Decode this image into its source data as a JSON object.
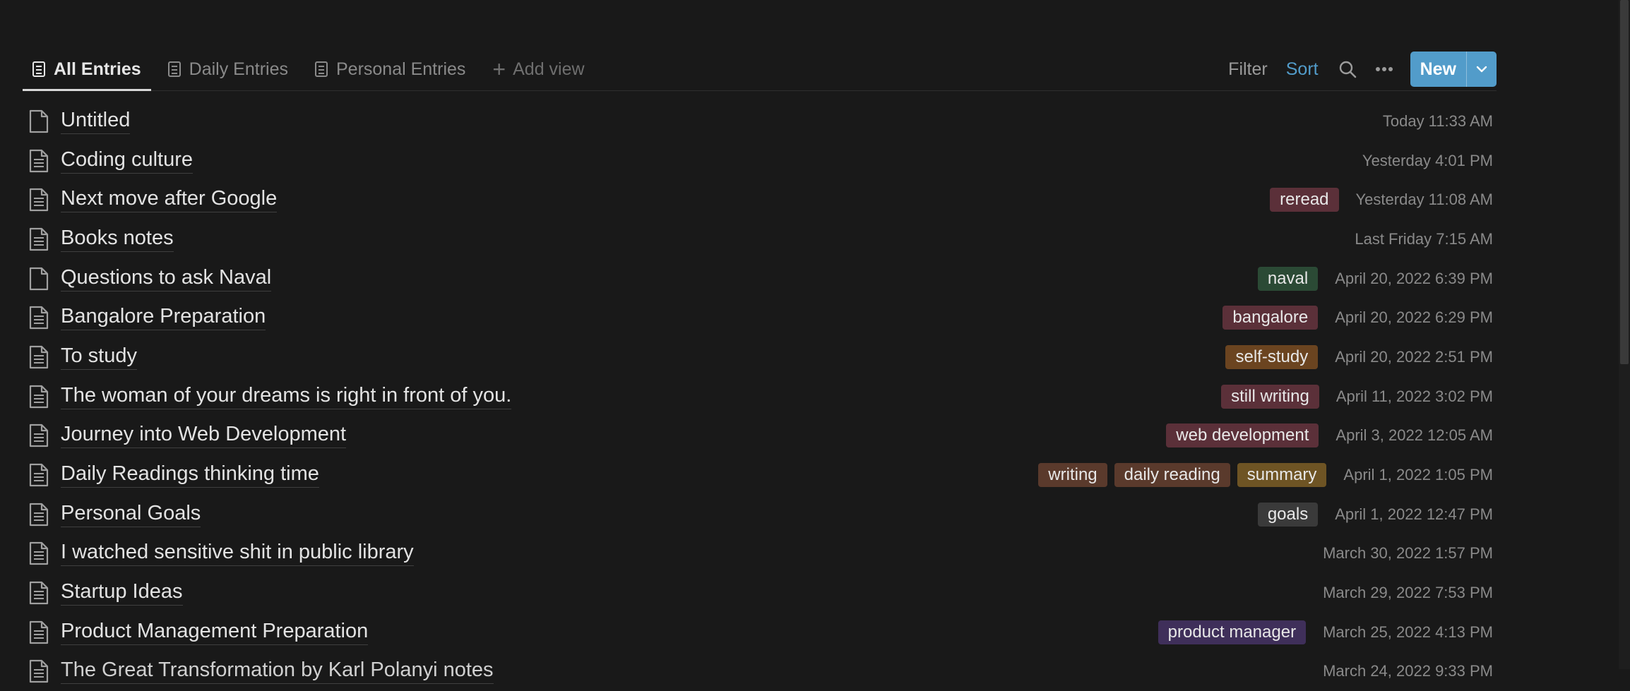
{
  "tabs": [
    {
      "label": "All Entries",
      "active": true
    },
    {
      "label": "Daily Entries",
      "active": false
    },
    {
      "label": "Personal Entries",
      "active": false
    }
  ],
  "add_view_label": "Add view",
  "actions": {
    "filter": "Filter",
    "sort": "Sort",
    "new": "New"
  },
  "icons": {
    "search": "search-icon",
    "more": "more-icon",
    "caret": "chevron-down-icon"
  },
  "tag_colors": {
    "red": "#5b3039",
    "green": "#2b4a35",
    "orange": "#6b4420",
    "brown": "#5a3a2c",
    "gold": "#6e5424",
    "gray": "#3a3a3a",
    "purple": "#3f2f5a"
  },
  "entries": [
    {
      "title": "Untitled",
      "icon": "blank",
      "tags": [],
      "date": "Today 11:33 AM"
    },
    {
      "title": "Coding culture",
      "icon": "text",
      "tags": [],
      "date": "Yesterday 4:01 PM"
    },
    {
      "title": "Next move after Google",
      "icon": "text",
      "tags": [
        {
          "label": "reread",
          "color": "red"
        }
      ],
      "date": "Yesterday 11:08 AM"
    },
    {
      "title": "Books notes",
      "icon": "text",
      "tags": [],
      "date": "Last Friday 7:15 AM"
    },
    {
      "title": "Questions to ask Naval",
      "icon": "blank",
      "tags": [
        {
          "label": "naval",
          "color": "green"
        }
      ],
      "date": "April 20, 2022 6:39 PM"
    },
    {
      "title": "Bangalore Preparation",
      "icon": "text",
      "tags": [
        {
          "label": "bangalore",
          "color": "red"
        }
      ],
      "date": "April 20, 2022 6:29 PM"
    },
    {
      "title": "To study",
      "icon": "text",
      "tags": [
        {
          "label": "self-study",
          "color": "orange"
        }
      ],
      "date": "April 20, 2022 2:51 PM"
    },
    {
      "title": "The woman of your dreams is right in front of you.",
      "icon": "text",
      "tags": [
        {
          "label": "still writing",
          "color": "red"
        }
      ],
      "date": "April 11, 2022 3:02 PM"
    },
    {
      "title": "Journey into Web Development",
      "icon": "text",
      "tags": [
        {
          "label": "web development",
          "color": "red"
        }
      ],
      "date": "April 3, 2022 12:05 AM"
    },
    {
      "title": "Daily Readings thinking time",
      "icon": "text",
      "tags": [
        {
          "label": "writing",
          "color": "brown"
        },
        {
          "label": "daily reading",
          "color": "brown"
        },
        {
          "label": "summary",
          "color": "gold"
        }
      ],
      "date": "April 1, 2022 1:05 PM"
    },
    {
      "title": "Personal Goals",
      "icon": "text",
      "tags": [
        {
          "label": "goals",
          "color": "gray"
        }
      ],
      "date": "April 1, 2022 12:47 PM"
    },
    {
      "title": "I watched sensitive shit in public library",
      "icon": "text",
      "tags": [],
      "date": "March 30, 2022 1:57 PM"
    },
    {
      "title": "Startup Ideas",
      "icon": "text",
      "tags": [],
      "date": "March 29, 2022 7:53 PM"
    },
    {
      "title": "Product Management Preparation",
      "icon": "text",
      "tags": [
        {
          "label": "product manager",
          "color": "purple"
        }
      ],
      "date": "March 25, 2022 4:13 PM"
    },
    {
      "title": "The Great Transformation by Karl Polanyi notes",
      "icon": "text",
      "tags": [],
      "date": "March 24, 2022 9:33 PM"
    }
  ]
}
